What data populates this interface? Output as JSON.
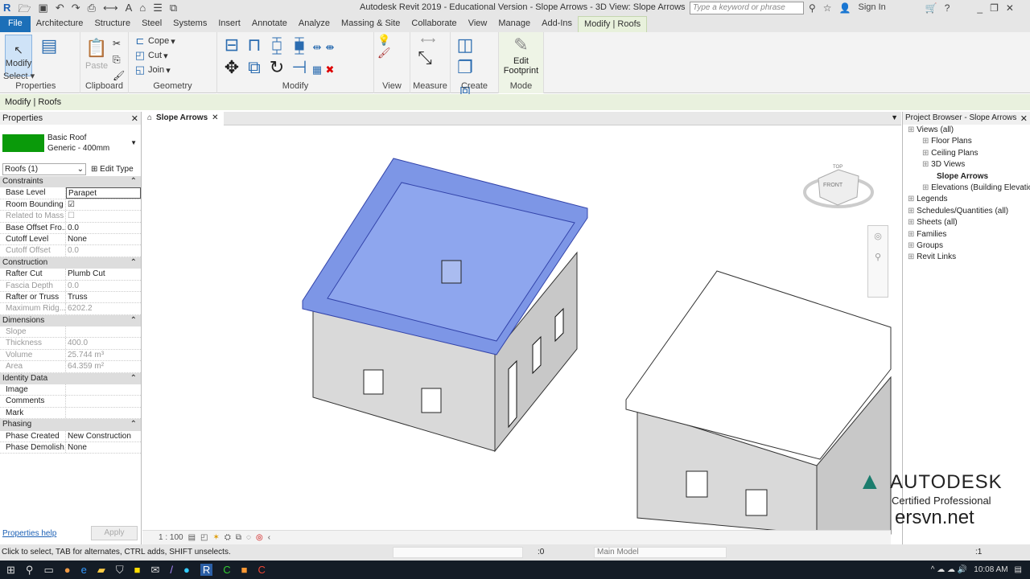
{
  "window": {
    "title": "Autodesk Revit 2019 - Educational Version - Slope Arrows - 3D View: Slope Arrows",
    "search_placeholder": "Type a keyword or phrase",
    "sign_in": "Sign In"
  },
  "ribbon_tabs": [
    "File",
    "Architecture",
    "Structure",
    "Steel",
    "Systems",
    "Insert",
    "Annotate",
    "Analyze",
    "Massing & Site",
    "Collaborate",
    "View",
    "Manage",
    "Add-Ins",
    "Modify | Roofs"
  ],
  "ribbon": {
    "select": "Select",
    "modify": "Modify",
    "properties": "Properties",
    "clipboard": "Clipboard",
    "paste": "Paste",
    "geometry": "Geometry",
    "cope": "Cope",
    "cut": "Cut",
    "join": "Join",
    "modify_panel": "Modify",
    "view": "View",
    "measure": "Measure",
    "create": "Create",
    "edit_footprint_1": "Edit",
    "edit_footprint_2": "Footprint",
    "mode": "Mode"
  },
  "context_bar": "Modify | Roofs",
  "properties": {
    "title": "Properties",
    "type_name": "Basic Roof",
    "type_sub": "Generic - 400mm",
    "swatch_color": "#0a9a0a",
    "filter": "Roofs (1)",
    "edit_type": "Edit Type",
    "groups": [
      {
        "name": "Constraints",
        "rows": [
          {
            "k": "Base Level",
            "v": "Parapet"
          },
          {
            "k": "Room Bounding",
            "v": "☑"
          },
          {
            "k": "Related to Mass",
            "v": "☐",
            "dis": true
          },
          {
            "k": "Base Offset Fro...",
            "v": "0.0"
          },
          {
            "k": "Cutoff Level",
            "v": "None"
          },
          {
            "k": "Cutoff Offset",
            "v": "0.0",
            "dis": true
          }
        ]
      },
      {
        "name": "Construction",
        "rows": [
          {
            "k": "Rafter Cut",
            "v": "Plumb Cut"
          },
          {
            "k": "Fascia Depth",
            "v": "0.0",
            "dis": true
          },
          {
            "k": "Rafter or Truss",
            "v": "Truss"
          },
          {
            "k": "Maximum Ridg...",
            "v": "6202.2",
            "dis": true
          }
        ]
      },
      {
        "name": "Dimensions",
        "rows": [
          {
            "k": "Slope",
            "v": "",
            "dis": true
          },
          {
            "k": "Thickness",
            "v": "400.0",
            "dis": true
          },
          {
            "k": "Volume",
            "v": "25.744 m³",
            "dis": true
          },
          {
            "k": "Area",
            "v": "64.359 m²",
            "dis": true
          }
        ]
      },
      {
        "name": "Identity Data",
        "rows": [
          {
            "k": "Image",
            "v": ""
          },
          {
            "k": "Comments",
            "v": ""
          },
          {
            "k": "Mark",
            "v": ""
          }
        ]
      },
      {
        "name": "Phasing",
        "rows": [
          {
            "k": "Phase Created",
            "v": "New Construction"
          },
          {
            "k": "Phase Demolish...",
            "v": "None"
          }
        ]
      }
    ],
    "help": "Properties help",
    "apply": "Apply"
  },
  "view": {
    "tab": "Slope Arrows",
    "scale": "1 : 100",
    "cube_top": "TOP",
    "cube_front": "FRONT"
  },
  "browser": {
    "title": "Project Browser - Slope Arrows",
    "items": [
      {
        "label": "Views (all)",
        "lvl": 0
      },
      {
        "label": "Floor Plans",
        "lvl": 1
      },
      {
        "label": "Ceiling Plans",
        "lvl": 1
      },
      {
        "label": "3D Views",
        "lvl": 1
      },
      {
        "label": "Slope Arrows",
        "lvl": 2,
        "bold": true
      },
      {
        "label": "Elevations (Building Elevation)",
        "lvl": 1
      },
      {
        "label": "Legends",
        "lvl": 0
      },
      {
        "label": "Schedules/Quantities (all)",
        "lvl": 0
      },
      {
        "label": "Sheets (all)",
        "lvl": 0
      },
      {
        "label": "Families",
        "lvl": 0
      },
      {
        "label": "Groups",
        "lvl": 0
      },
      {
        "label": "Revit Links",
        "lvl": 0
      }
    ]
  },
  "status": {
    "hint": "Click to select, TAB for alternates, CTRL adds, SHIFT unselects.",
    "workset_count": ":0",
    "model": "Main Model",
    "filter_count": ":1"
  },
  "watermark": {
    "brand": "AUTODESK",
    "sub": "Certified Professional",
    "site": "ersvn.net"
  },
  "taskbar": {
    "time": "10:08 AM"
  }
}
